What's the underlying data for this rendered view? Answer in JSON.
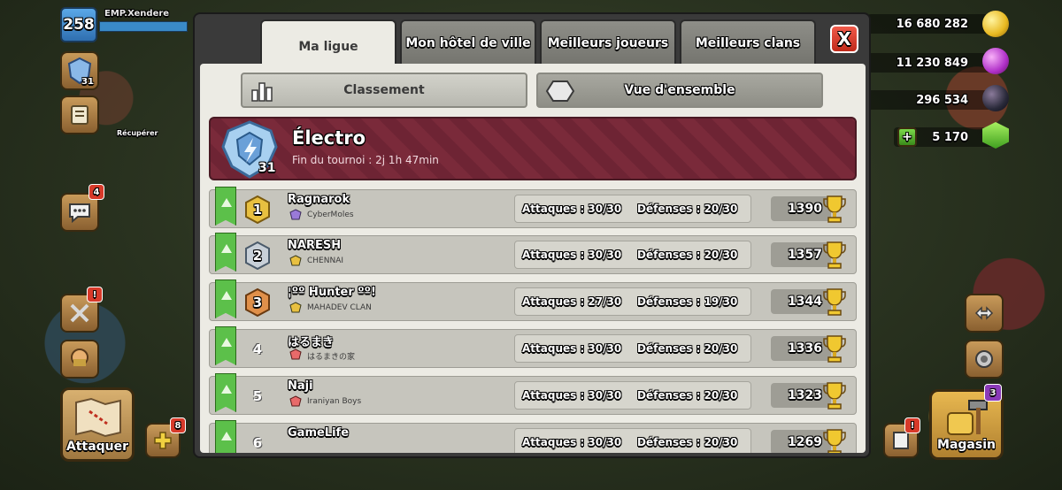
{
  "hud": {
    "level": "258",
    "player_name": "EMP.Xendere",
    "league_badge_num": "31",
    "retrieve_label": "Récupérer",
    "chat_badge": "4",
    "attack_badge": "!",
    "attack_label": "Attaquer",
    "reinforce_badge": "8",
    "gold": "16 680 282",
    "elixir": "11 230 849",
    "dark_elixir": "296 534",
    "gems": "5 170",
    "shop_label": "Magasin",
    "shop_badge": "3",
    "notes_badge": "!"
  },
  "tabs": [
    {
      "label": "Ma ligue"
    },
    {
      "label": "Mon hôtel de ville"
    },
    {
      "label": "Meilleurs joueurs"
    },
    {
      "label": "Meilleurs clans"
    }
  ],
  "close_label": "X",
  "subtabs": [
    {
      "label": "Classement"
    },
    {
      "label": "Vue d'ensemble"
    }
  ],
  "league": {
    "name": "Électro",
    "timer": "Fin du tournoi : 2j 1h 47min",
    "num": "31"
  },
  "players": [
    {
      "rank": "1",
      "name": "Ragnarok",
      "clan": "CyberMoles",
      "attacks": "Attaques : 30/30",
      "defenses": "Défenses : 20/30",
      "trophies": "1390",
      "badge": "gold"
    },
    {
      "rank": "2",
      "name": "NARESH",
      "clan": "CHENNAI",
      "attacks": "Attaques : 30/30",
      "defenses": "Défenses : 20/30",
      "trophies": "1357",
      "badge": "silver"
    },
    {
      "rank": "3",
      "name": "¦ºº Hunter ºº!",
      "clan": "MAHADEV CLAN",
      "attacks": "Attaques : 27/30",
      "defenses": "Défenses : 19/30",
      "trophies": "1344",
      "badge": "bronze"
    },
    {
      "rank": "4",
      "name": "はるまき",
      "clan": "はるまきの家",
      "attacks": "Attaques : 30/30",
      "defenses": "Défenses : 20/30",
      "trophies": "1336",
      "badge": "none"
    },
    {
      "rank": "5",
      "name": "Naji",
      "clan": "Iraniyan Boys",
      "attacks": "Attaques : 30/30",
      "defenses": "Défenses : 20/30",
      "trophies": "1323",
      "badge": "none"
    },
    {
      "rank": "6",
      "name": "GameLife",
      "clan": "",
      "attacks": "Attaques : 30/30",
      "defenses": "Défenses : 20/30",
      "trophies": "1269",
      "badge": "none"
    }
  ]
}
